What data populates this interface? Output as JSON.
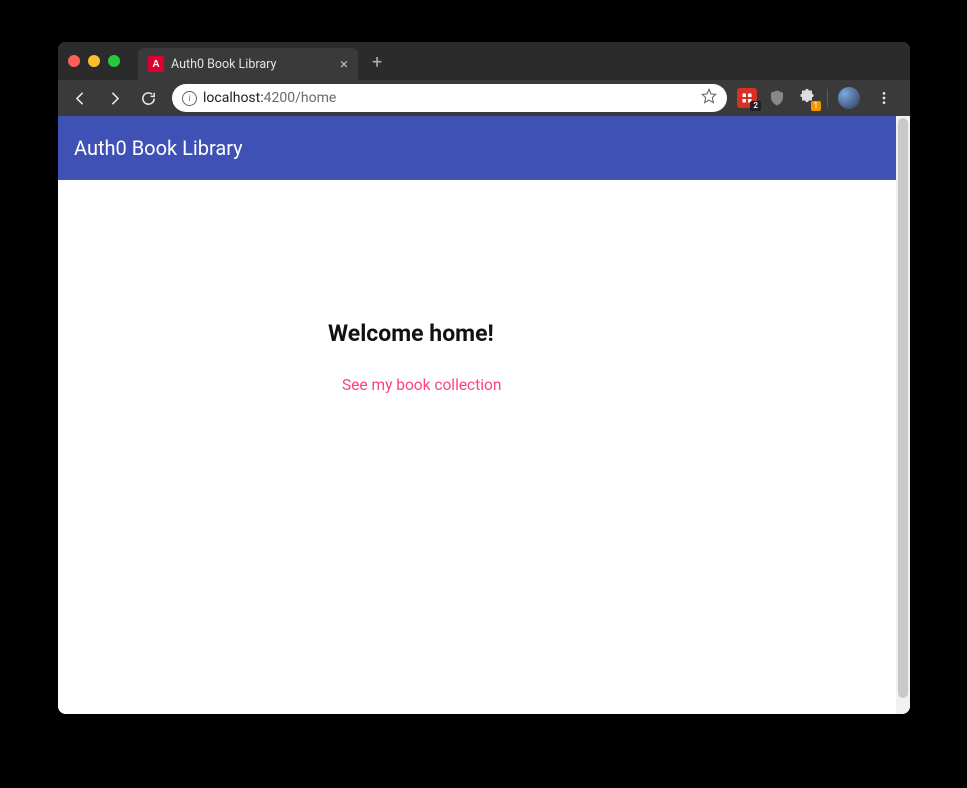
{
  "browser": {
    "tab_title": "Auth0 Book Library",
    "favicon_letter": "A",
    "url_host": "localhost:",
    "url_port_path": "4200/home",
    "extensions": {
      "item1_badge": "2",
      "item3_badge": "1"
    }
  },
  "page": {
    "header_title": "Auth0 Book Library",
    "welcome_heading": "Welcome home!",
    "collection_link": "See my book collection"
  }
}
